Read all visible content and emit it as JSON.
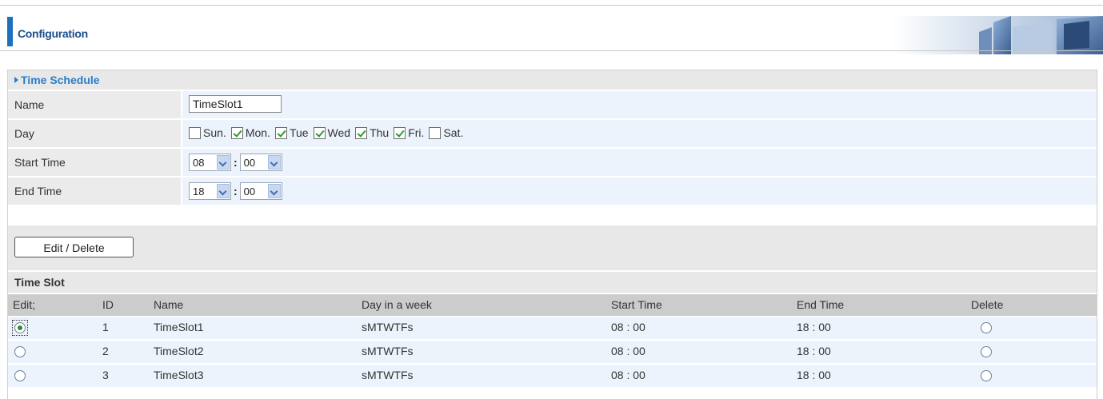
{
  "header": {
    "title": "Configuration"
  },
  "section": {
    "title": "Time Schedule"
  },
  "form": {
    "name_label": "Name",
    "name_value": "TimeSlot1",
    "day_label": "Day",
    "days": [
      {
        "label": "Sun.",
        "checked": false
      },
      {
        "label": "Mon.",
        "checked": true
      },
      {
        "label": "Tue",
        "checked": true
      },
      {
        "label": "Wed",
        "checked": true
      },
      {
        "label": "Thu",
        "checked": true
      },
      {
        "label": "Fri.",
        "checked": true
      },
      {
        "label": "Sat.",
        "checked": false
      }
    ],
    "start_label": "Start Time",
    "start_hour": "08",
    "start_min": "00",
    "end_label": "End Time",
    "end_hour": "18",
    "end_min": "00",
    "colon": ":"
  },
  "buttons": {
    "edit_delete": "Edit / Delete"
  },
  "slots": {
    "title": "Time Slot",
    "columns": [
      "Edit;",
      "ID",
      "Name",
      "Day in a week",
      "Start Time",
      "End Time",
      "Delete"
    ],
    "rows": [
      {
        "id": "1",
        "name": "TimeSlot1",
        "days": "sMTWTFs",
        "start": "08 : 00",
        "end": "18 : 00",
        "selected": true
      },
      {
        "id": "2",
        "name": "TimeSlot2",
        "days": "sMTWTFs",
        "start": "08 : 00",
        "end": "18 : 00",
        "selected": false
      },
      {
        "id": "3",
        "name": "TimeSlot3",
        "days": "sMTWTFs",
        "start": "08 : 00",
        "end": "18 : 00",
        "selected": false
      }
    ]
  },
  "colors": {
    "accent": "#1d6fc0",
    "section_title": "#2b7dc9",
    "value_bg": "#edf3fc",
    "label_bg": "#ebebeb",
    "check": "#2e9a2e"
  }
}
